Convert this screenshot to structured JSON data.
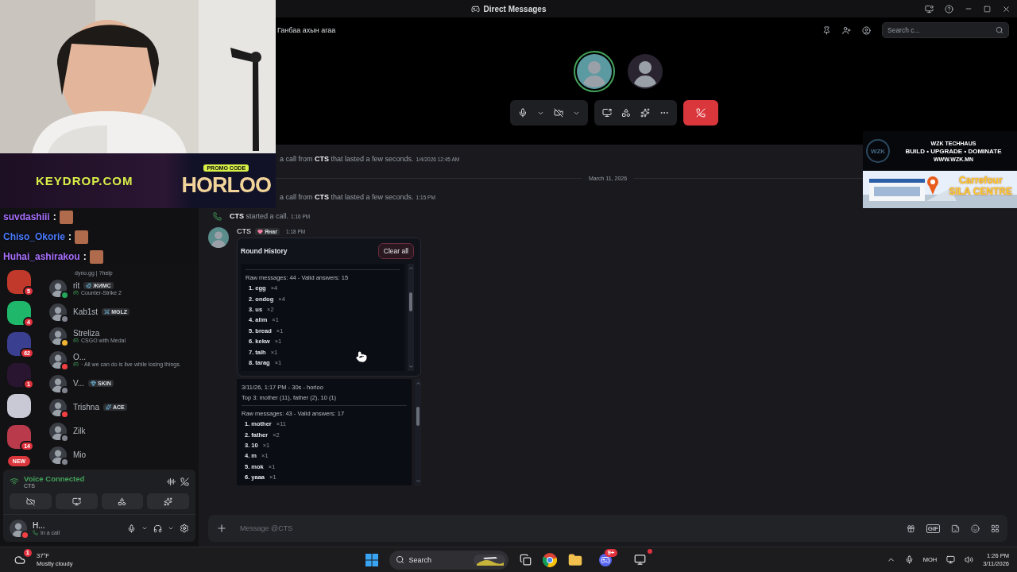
{
  "window": {
    "title": "Direct Messages"
  },
  "stream_overlay": {
    "promo_site": "KEYDROP.COM",
    "promo_label": "PROMO CODE",
    "promo_code": "HORLOO",
    "chat": [
      {
        "user": "suvdashiii",
        "sep": ":",
        "color": "#a970ff"
      },
      {
        "user": "Chiso_Okorie",
        "sep": ":",
        "color": "#4a7bff"
      },
      {
        "user": "Huhai_ashirakou",
        "sep": ":",
        "color": "#a970ff"
      }
    ]
  },
  "ads": {
    "brand": "WZK TECHHAUS",
    "logo": "WZK",
    "tagline": "BUILD • UPGRADE • DOMINATE",
    "url": "WWW.WZK.MN",
    "store_name": "Carrefour",
    "store_place": "SILA CENTRE"
  },
  "server_rail": [
    {
      "kind": "badged",
      "badge": "5"
    },
    {
      "kind": "badged",
      "badge": "4"
    },
    {
      "kind": "badged",
      "badge": "62"
    },
    {
      "kind": "badged",
      "badge": "1"
    },
    {
      "kind": "plain"
    },
    {
      "kind": "badged",
      "badge": "14"
    },
    {
      "kind": "new",
      "label": "NEW"
    }
  ],
  "dm_list": {
    "partial_status": "dyno.gg | ?help",
    "items": [
      {
        "name": "rit",
        "tag": "ЖИМС",
        "status": "Counter-Strike 2",
        "color": "#23a55a"
      },
      {
        "name": "Kab1st",
        "tag": "MGLZ",
        "color": "#80848e"
      },
      {
        "name": "Streliza",
        "status": "CSGO with Medal",
        "color": "#f0b232"
      },
      {
        "name": "O...",
        "status": "· All we can do is live while losing things.",
        "color": "#f23f43"
      },
      {
        "name": "V...",
        "tag": "SKIN",
        "color": "#80848e"
      },
      {
        "name": "Trishna",
        "tag": "ACE",
        "color": "#f23f43"
      },
      {
        "name": "Zilk",
        "color": "#80848e"
      },
      {
        "name": "Mio",
        "color": "#80848e"
      }
    ]
  },
  "voice_panel": {
    "title": "Voice Connected",
    "channel": "CTS"
  },
  "user_panel": {
    "name": "H...",
    "status": "In a call",
    "color": "#f23f43"
  },
  "call": {
    "title": "Ганбаа ахын агаа",
    "search_placeholder": "Search c...",
    "participants": [
      {
        "speaking": true
      },
      {
        "speaking": false
      }
    ]
  },
  "chat": {
    "messages": [
      {
        "kind": "call_log",
        "text": "a call from **CTS** that lasted a few seconds.",
        "time": "1/4/2026 12:45 AM"
      },
      {
        "kind": "divider",
        "label": "March 11, 2026"
      },
      {
        "kind": "call_log",
        "text": "a call from **CTS** that lasted a few seconds.",
        "time": "1:15 PM"
      },
      {
        "kind": "call_start",
        "text": "**CTS** started a call.",
        "time": "1:16 PM"
      },
      {
        "kind": "message",
        "author": "CTS",
        "tag": "Янаг",
        "time": "1:18 PM",
        "embed": {
          "title": "Round History",
          "action": "Clear all",
          "rounds": [
            {
              "raw": "Raw messages: 44 - Valid answers: 15",
              "answers": [
                {
                  "word": "1. egg",
                  "count": "×4"
                },
                {
                  "word": "2. ondog",
                  "count": "×4"
                },
                {
                  "word": "3. us",
                  "count": "×2"
                },
                {
                  "word": "4. alim",
                  "count": "×1"
                },
                {
                  "word": "5. bread",
                  "count": "×1"
                },
                {
                  "word": "6. kekw",
                  "count": "×1"
                },
                {
                  "word": "7. talh",
                  "count": "×1"
                },
                {
                  "word": "8. tarag",
                  "count": "×1"
                }
              ]
            },
            {
              "header": "3/11/26, 1:17 PM - 30s - horloo",
              "top": "Top 3: mother (11), father (2), 10 (1)",
              "raw": "Raw messages: 43 - Valid answers: 17",
              "answers": [
                {
                  "word": "1. mother",
                  "count": "×11"
                },
                {
                  "word": "2. father",
                  "count": "×2"
                },
                {
                  "word": "3. 10",
                  "count": "×1"
                },
                {
                  "word": "4. m",
                  "count": "×1"
                },
                {
                  "word": "5. mok",
                  "count": "×1"
                },
                {
                  "word": "6. yaaa",
                  "count": "×1"
                }
              ]
            }
          ]
        }
      }
    ]
  },
  "composer": {
    "placeholder": "Message @CTS",
    "gif": "GIF"
  },
  "taskbar": {
    "weather_badge": "1",
    "temperature": "37°F",
    "weather": "Mostly cloudy",
    "search": "Search",
    "discord_badge": "9+",
    "language": "MOH",
    "time": "1:26 PM",
    "date": "3/11/2026"
  }
}
